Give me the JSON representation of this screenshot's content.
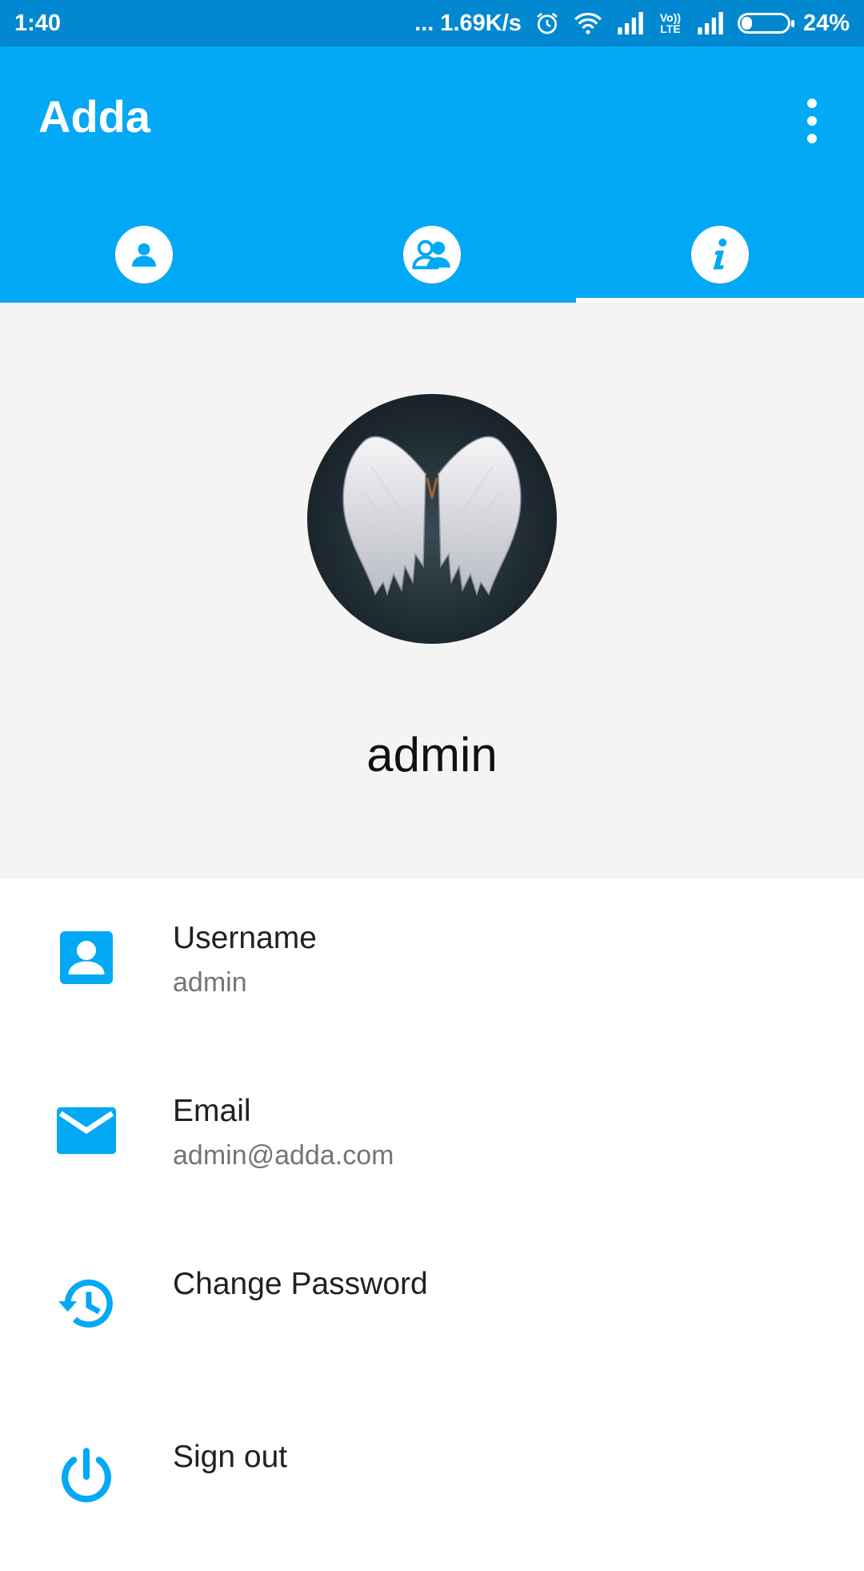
{
  "status_bar": {
    "time": "1:40",
    "speed": "... 1.69K/s",
    "volte": "Vo)) LTE",
    "battery": "24%",
    "battery_level": 0.24
  },
  "app_bar": {
    "title": "Adda",
    "menu_icon": "more-vert-icon",
    "tabs": [
      {
        "icon": "person-icon",
        "active": false
      },
      {
        "icon": "group-icon",
        "active": false
      },
      {
        "icon": "info-icon",
        "active": true
      }
    ]
  },
  "profile": {
    "name": "admin",
    "avatar_icon": "angel-wings-image"
  },
  "details": [
    {
      "icon": "account-box-icon",
      "label": "Username",
      "value": "admin"
    },
    {
      "icon": "email-icon",
      "label": "Email",
      "value": "admin@adda.com"
    },
    {
      "icon": "history-icon",
      "label": "Change Password"
    },
    {
      "icon": "power-icon",
      "label": "Sign out"
    }
  ],
  "colors": {
    "primary": "#03a9f4",
    "primary_dark": "#0288d1",
    "background": "#f4f4f4"
  }
}
